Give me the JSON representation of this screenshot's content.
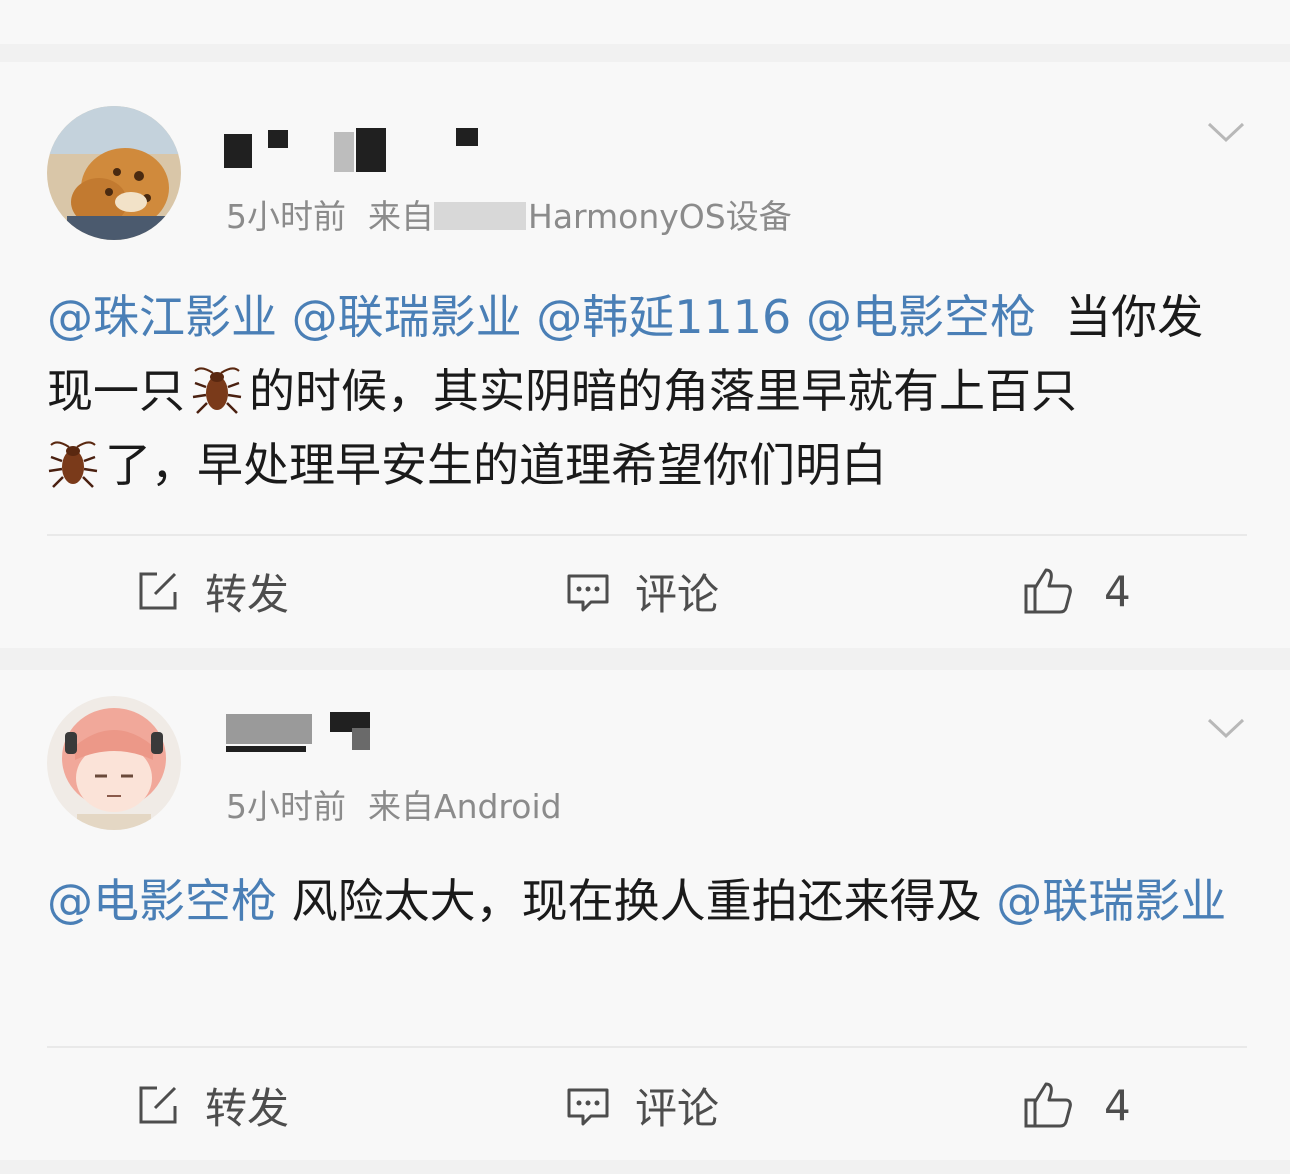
{
  "posts": [
    {
      "username": "",
      "time": "5小时前",
      "source_prefix": "来自",
      "source_visible": "HarmonyOS设备",
      "mentions": [
        "@珠江影业",
        "@联瑞影业",
        "@韩延1116",
        "@电影空枪"
      ],
      "text_a": "当你发现一只",
      "text_b": "的时候，其实阴暗的角落里早就有上百只",
      "text_c": "了，早处理早安生的道理希望你们明白",
      "emoji": "cockroach-emoji",
      "actions": {
        "repost": "转发",
        "comment": "评论",
        "like_count": "4"
      }
    },
    {
      "username": "",
      "time": "5小时前",
      "source": "来自Android",
      "mention_1": "@电影空枪",
      "text": " 风险太大，现在换人重拍还来得及",
      "mention_2": "@联瑞影业",
      "actions": {
        "repost": "转发",
        "comment": "评论",
        "like_count": "4"
      }
    }
  ],
  "icons": {
    "menu": "chevron-down-icon",
    "repost": "edit-share-icon",
    "comment": "comment-icon",
    "like": "thumb-up-icon"
  },
  "colors": {
    "mention": "#4a7fb6",
    "text": "#1a1a1a",
    "meta": "#8b8b8b",
    "background": "#f8f8f8",
    "separator": "#f1f1f1"
  }
}
